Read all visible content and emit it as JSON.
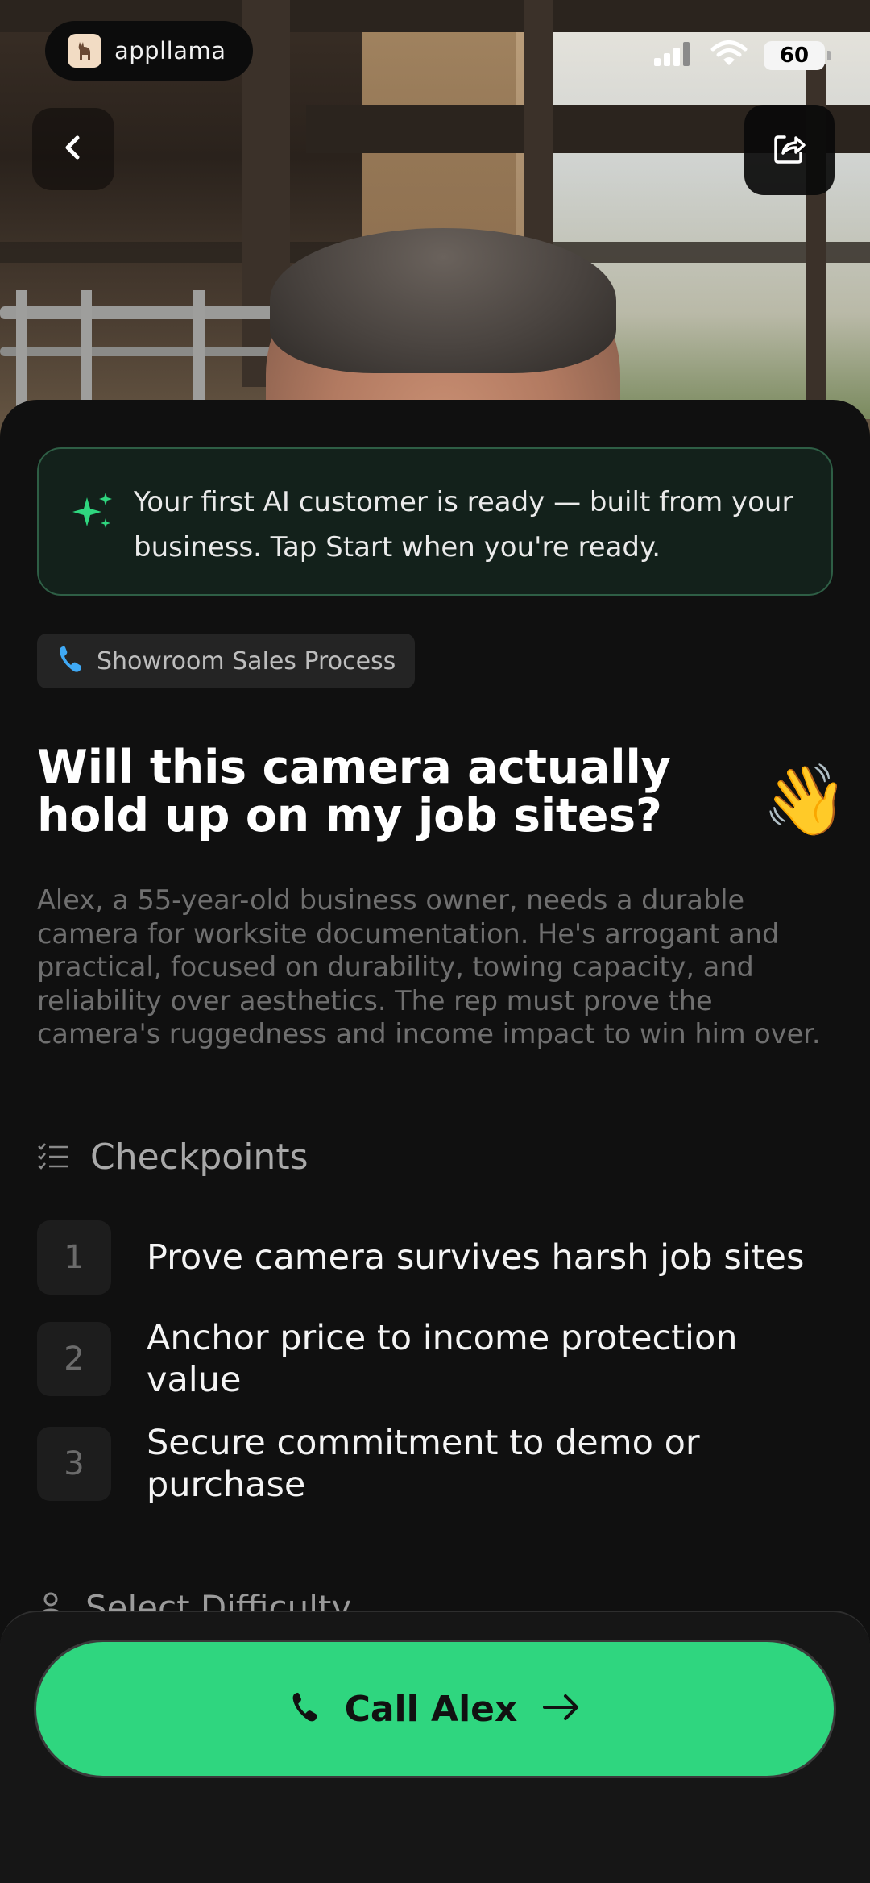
{
  "status_bar": {
    "brand": "appllama",
    "battery": "60"
  },
  "banner": {
    "text": "Your first AI customer is ready — built from your business. Tap Start when you're ready."
  },
  "scenario_tag": "Showroom Sales Process",
  "scenario": {
    "title": "Will this camera actually hold up on my job sites?",
    "emoji": "👋",
    "description": "Alex, a 55-year-old business owner, needs a durable camera for worksite documentation. He's arrogant and practical, focused on durability, towing capacity, and reliability over aesthetics. The rep must prove the camera's ruggedness and income impact to win him over."
  },
  "checkpoints": {
    "heading": "Checkpoints",
    "items": [
      {
        "number": "1",
        "text": "Prove camera survives harsh job sites"
      },
      {
        "number": "2",
        "text": "Anchor price to income protection value"
      },
      {
        "number": "3",
        "text": "Secure commitment to demo or purchase"
      }
    ]
  },
  "difficulty": {
    "heading": "Select Difficulty"
  },
  "cta": {
    "label": "Call Alex"
  },
  "colors": {
    "accent_green": "#2fd67f",
    "banner_border": "#2e5e45",
    "phone_icon_blue": "#3fa9f5",
    "background": "#101010"
  },
  "icons": {
    "back": "chevron-left-icon",
    "share": "share-icon",
    "banner": "sparkles-icon",
    "tag": "phone-icon",
    "checkpoints": "checklist-icon",
    "difficulty": "person-icon",
    "cta_left": "phone-icon",
    "cta_right": "arrow-right-icon"
  }
}
